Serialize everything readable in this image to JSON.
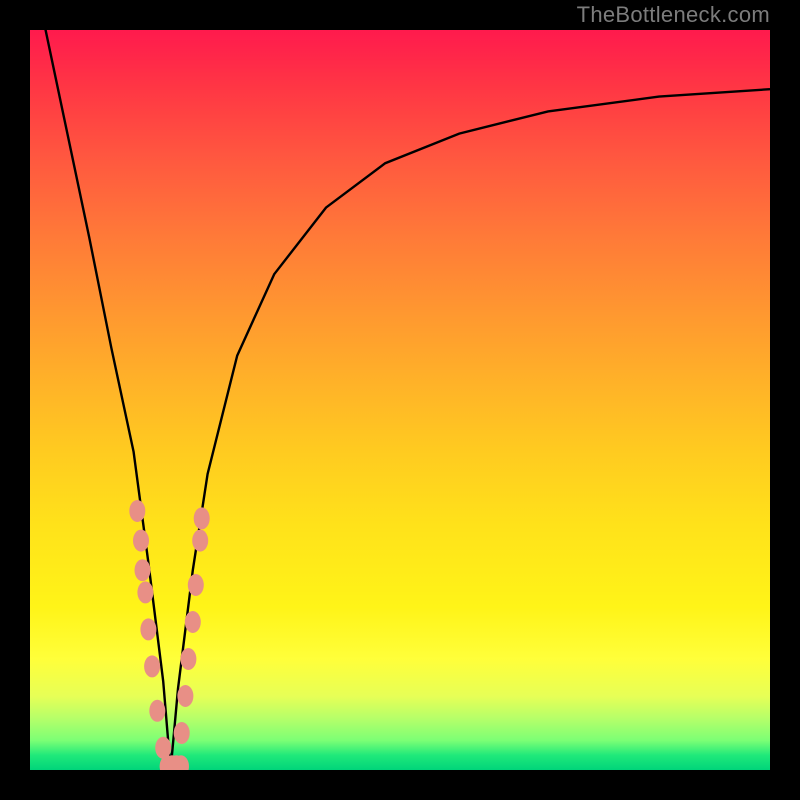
{
  "watermark": "TheBottleneck.com",
  "chart_data": {
    "type": "line",
    "title": "",
    "xlabel": "",
    "ylabel": "",
    "xlim": [
      0,
      100
    ],
    "ylim": [
      0,
      100
    ],
    "note": "V-shaped bottleneck curve; vertical axis ≈ bottleneck %, background gradient encodes severity (red=high, green=low). Minimum near x≈19.",
    "series": [
      {
        "name": "bottleneck-curve",
        "x": [
          0,
          4,
          8,
          11,
          14,
          16,
          18,
          19,
          20,
          22,
          24,
          28,
          33,
          40,
          48,
          58,
          70,
          85,
          100
        ],
        "values": [
          110,
          91,
          72,
          57,
          43,
          28,
          12,
          0,
          11,
          27,
          40,
          56,
          67,
          76,
          82,
          86,
          89,
          91,
          92
        ]
      }
    ],
    "markers": {
      "name": "sample-points",
      "color": "#e88f86",
      "points": [
        {
          "x": 14.5,
          "y": 35
        },
        {
          "x": 15.0,
          "y": 31
        },
        {
          "x": 15.2,
          "y": 27
        },
        {
          "x": 15.6,
          "y": 24
        },
        {
          "x": 16.0,
          "y": 19
        },
        {
          "x": 16.5,
          "y": 14
        },
        {
          "x": 17.2,
          "y": 8
        },
        {
          "x": 18.0,
          "y": 3
        },
        {
          "x": 18.6,
          "y": 0.5
        },
        {
          "x": 19.2,
          "y": 0.5
        },
        {
          "x": 19.8,
          "y": 0.5
        },
        {
          "x": 20.4,
          "y": 0.5
        },
        {
          "x": 20.5,
          "y": 5
        },
        {
          "x": 21.0,
          "y": 10
        },
        {
          "x": 21.4,
          "y": 15
        },
        {
          "x": 22.0,
          "y": 20
        },
        {
          "x": 22.4,
          "y": 25
        },
        {
          "x": 23.0,
          "y": 31
        },
        {
          "x": 23.2,
          "y": 34
        }
      ]
    },
    "gradient_stops": [
      {
        "pct": 0,
        "color": "#ff1a4d"
      },
      {
        "pct": 50,
        "color": "#ffcb20"
      },
      {
        "pct": 85,
        "color": "#ffff3a"
      },
      {
        "pct": 100,
        "color": "#00d47a"
      }
    ]
  }
}
